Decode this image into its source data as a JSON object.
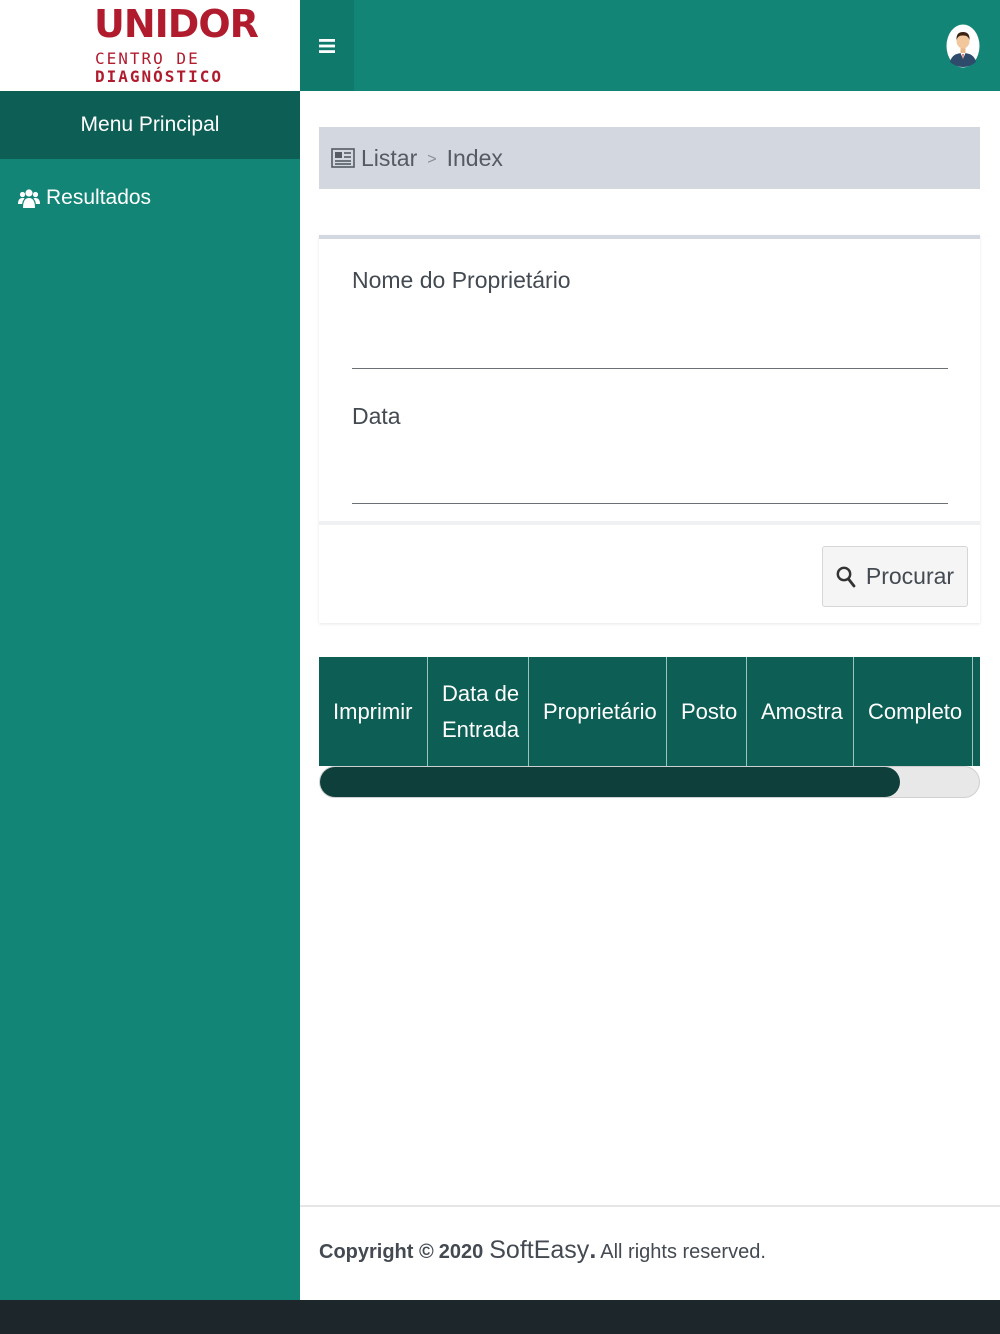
{
  "logo": {
    "title": "UNIDOR",
    "subtitle_line1": "CENTRO DE",
    "subtitle_line2": "DIAGNÓSTICO"
  },
  "sidebar": {
    "header": "Menu Principal",
    "items": [
      {
        "label": "Resultados",
        "icon": "users-icon"
      }
    ]
  },
  "topbar": {
    "menu_icon": "hamburger-icon",
    "avatar_icon": "user-avatar-icon"
  },
  "breadcrumb": {
    "items": [
      "Listar",
      "Index"
    ],
    "separator": ">"
  },
  "form": {
    "owner_label": "Nome do Proprietário",
    "owner_value": "",
    "date_label": "Data",
    "date_value": "",
    "search_button": "Procurar"
  },
  "table": {
    "columns": [
      "Imprimir",
      "Data de Entrada",
      "Proprietário",
      "Posto",
      "Amostra",
      "Completo"
    ]
  },
  "footer": {
    "copyright": "Copyright ©",
    "year": "2020",
    "brand_a": "Soft",
    "brand_b": "Easy",
    "brand_dot": ".",
    "rights": "All rights reserved."
  },
  "colors": {
    "primary": "#128576",
    "primary_dark": "#0d5e54",
    "logo_red": "#b01c2e",
    "scroll_thumb": "#0e3f3b"
  }
}
